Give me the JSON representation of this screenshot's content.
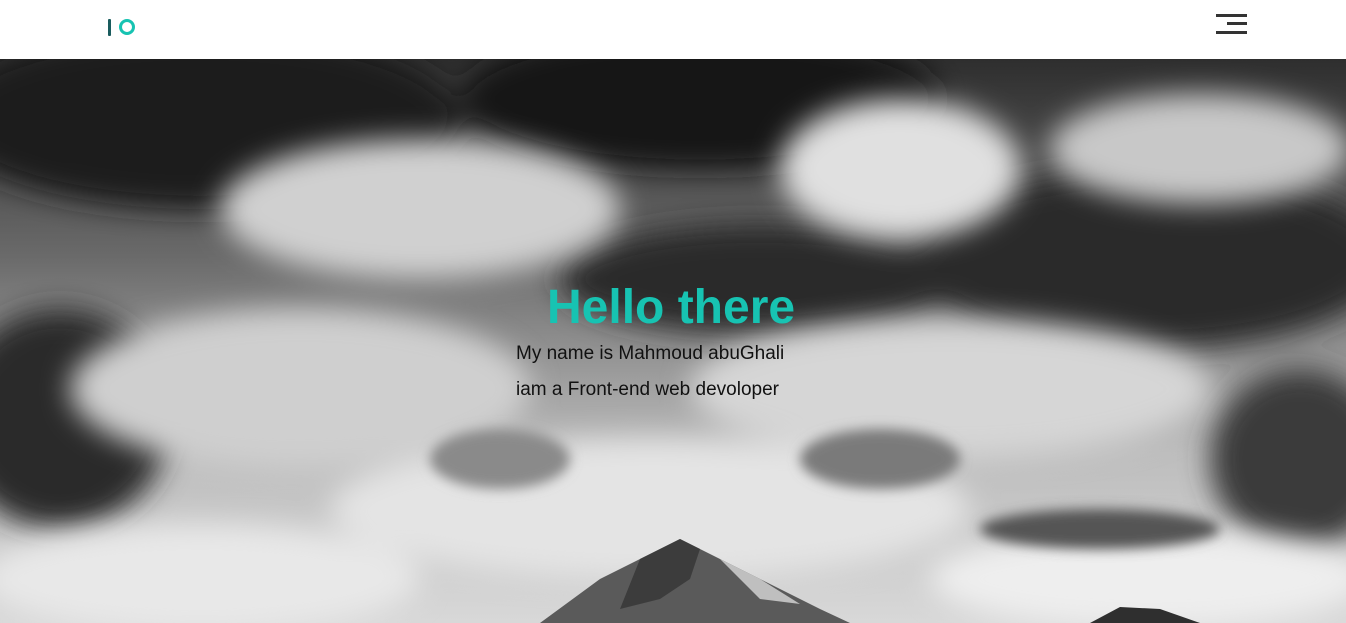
{
  "header": {
    "logo_icon": "io-logo-icon",
    "menu_icon": "hamburger-menu-icon"
  },
  "hero": {
    "title": "Hello there",
    "line1": "My name is Mahmoud abuGhali",
    "line2": "iam a Front-end web devoloper",
    "background": "grayscale-clouds-mountain-photo"
  },
  "colors": {
    "accent": "#17c3b2",
    "logo_bar": "#1a5c5e",
    "menu": "#333333",
    "text": "#111111"
  }
}
